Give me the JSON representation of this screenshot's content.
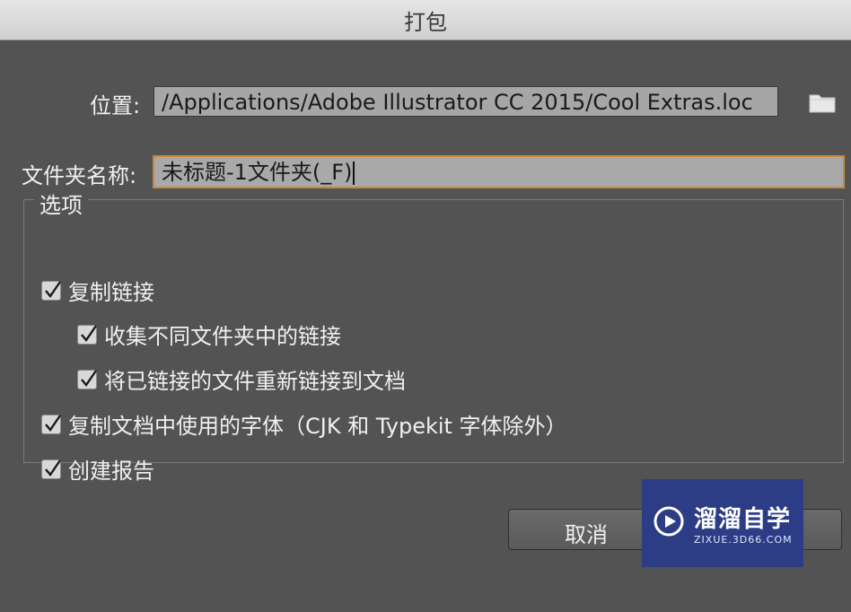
{
  "window": {
    "title": "打包"
  },
  "location": {
    "label": "位置:",
    "value": "/Applications/Adobe Illustrator CC 2015/Cool Extras.loc"
  },
  "folder_name": {
    "label": "文件夹名称:",
    "value": "未标题-1文件夹(_F)"
  },
  "options": {
    "legend": "选项",
    "items": [
      {
        "label": "复制链接",
        "checked": true
      },
      {
        "label": "收集不同文件夹中的链接",
        "checked": true
      },
      {
        "label": "将已链接的文件重新链接到文档",
        "checked": true
      },
      {
        "label": "复制文档中使用的字体（CJK 和 Typekit 字体除外）",
        "checked": true
      },
      {
        "label": "创建报告",
        "checked": true
      }
    ]
  },
  "buttons": {
    "cancel_label": "取消"
  },
  "watermark": {
    "title": "溜溜自学",
    "subtitle": "ZIXUE.3D66.COM"
  },
  "colors": {
    "background": "#535353",
    "focus_border": "#c8893a",
    "watermark_bg": "#2c3d86"
  }
}
